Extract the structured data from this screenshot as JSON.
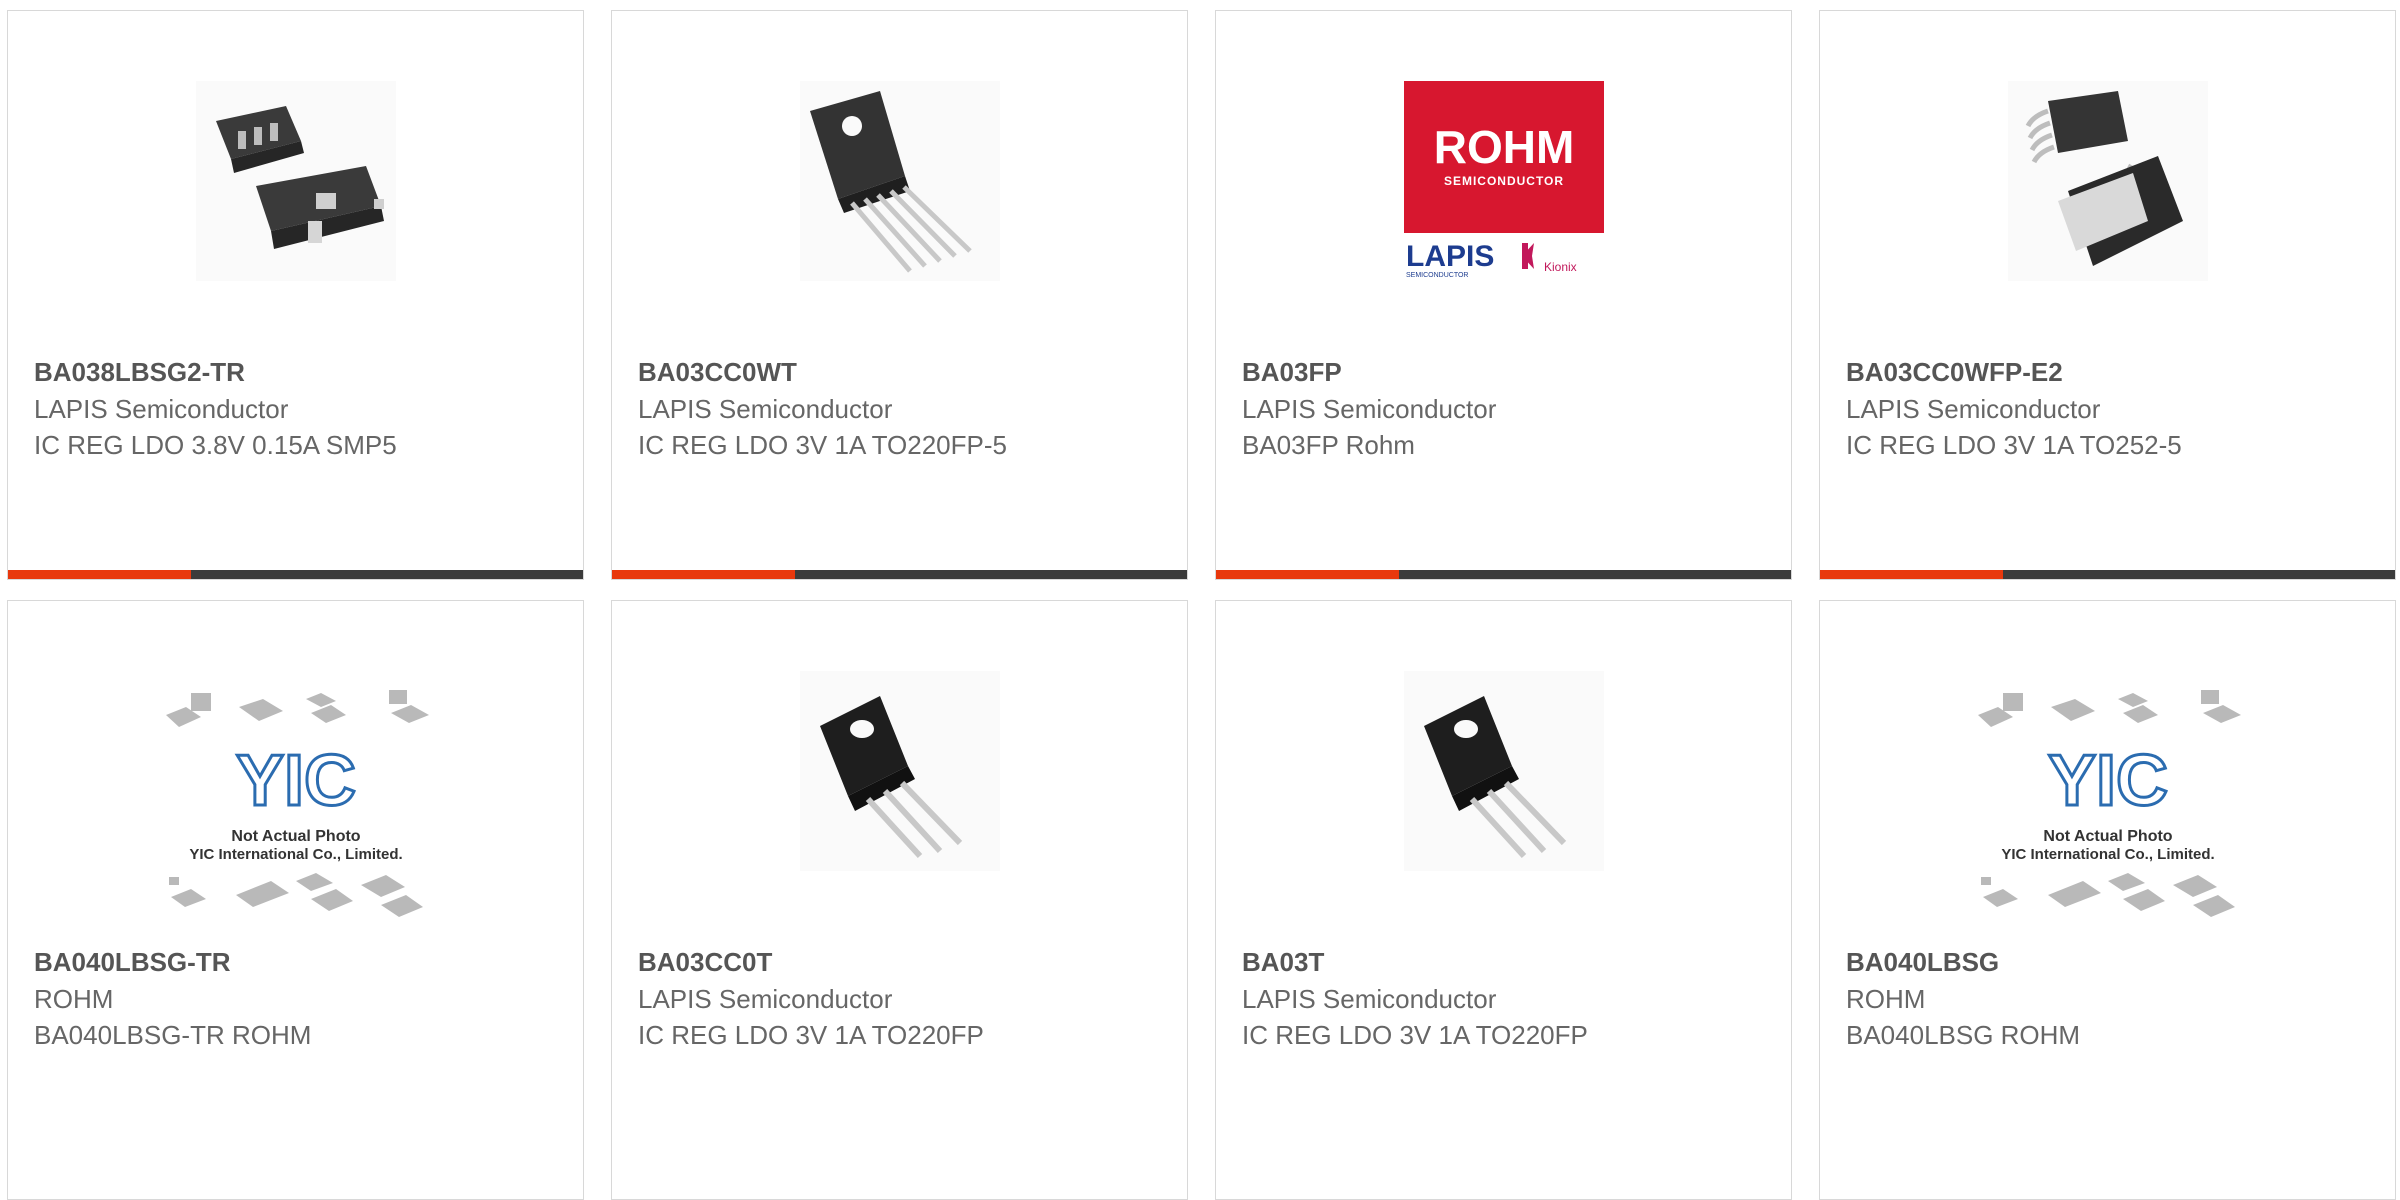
{
  "colors": {
    "accent": "#e8380d",
    "bar": "#3b3b3b",
    "rohm_red": "#d7172f",
    "lapis_blue": "#1d3c8f"
  },
  "products": [
    {
      "part": "BA038LBSG2-TR",
      "maker": "LAPIS Semiconductor",
      "desc": "IC REG LDO 3.8V 0.15A SMP5",
      "image": "smp5-package-image"
    },
    {
      "part": "BA03CC0WT",
      "maker": "LAPIS Semiconductor",
      "desc": "IC REG LDO 3V 1A TO220FP-5",
      "image": "to220fp-5-package-image"
    },
    {
      "part": "BA03FP",
      "maker": "LAPIS Semiconductor",
      "desc": "BA03FP Rohm",
      "image": "rohm-logo-image",
      "logo": {
        "brand": "ROHM",
        "brand_sub": "SEMICONDUCTOR",
        "lapis": "LAPIS",
        "lapis_sub": "SEMICONDUCTOR",
        "kionix": "Kionix"
      }
    },
    {
      "part": "BA03CC0WFP-E2",
      "maker": "LAPIS Semiconductor",
      "desc": "IC REG LDO 3V 1A TO252-5",
      "image": "to252-5-package-image"
    },
    {
      "part": "BA040LBSG-TR",
      "maker": "ROHM",
      "desc": "BA040LBSG-TR ROHM",
      "image": "placeholder-image",
      "placeholder": {
        "logo": "YIC",
        "line1": "Not Actual Photo",
        "line2": "YIC International Co., Limited."
      }
    },
    {
      "part": "BA03CC0T",
      "maker": "LAPIS Semiconductor",
      "desc": "IC REG LDO 3V 1A TO220FP",
      "image": "to220fp-package-image"
    },
    {
      "part": "BA03T",
      "maker": "LAPIS Semiconductor",
      "desc": "IC REG LDO 3V 1A TO220FP",
      "image": "to220fp-package-image"
    },
    {
      "part": "BA040LBSG",
      "maker": "ROHM",
      "desc": "BA040LBSG ROHM",
      "image": "placeholder-image",
      "placeholder": {
        "logo": "YIC",
        "line1": "Not Actual Photo",
        "line2": "YIC International Co., Limited."
      }
    }
  ]
}
